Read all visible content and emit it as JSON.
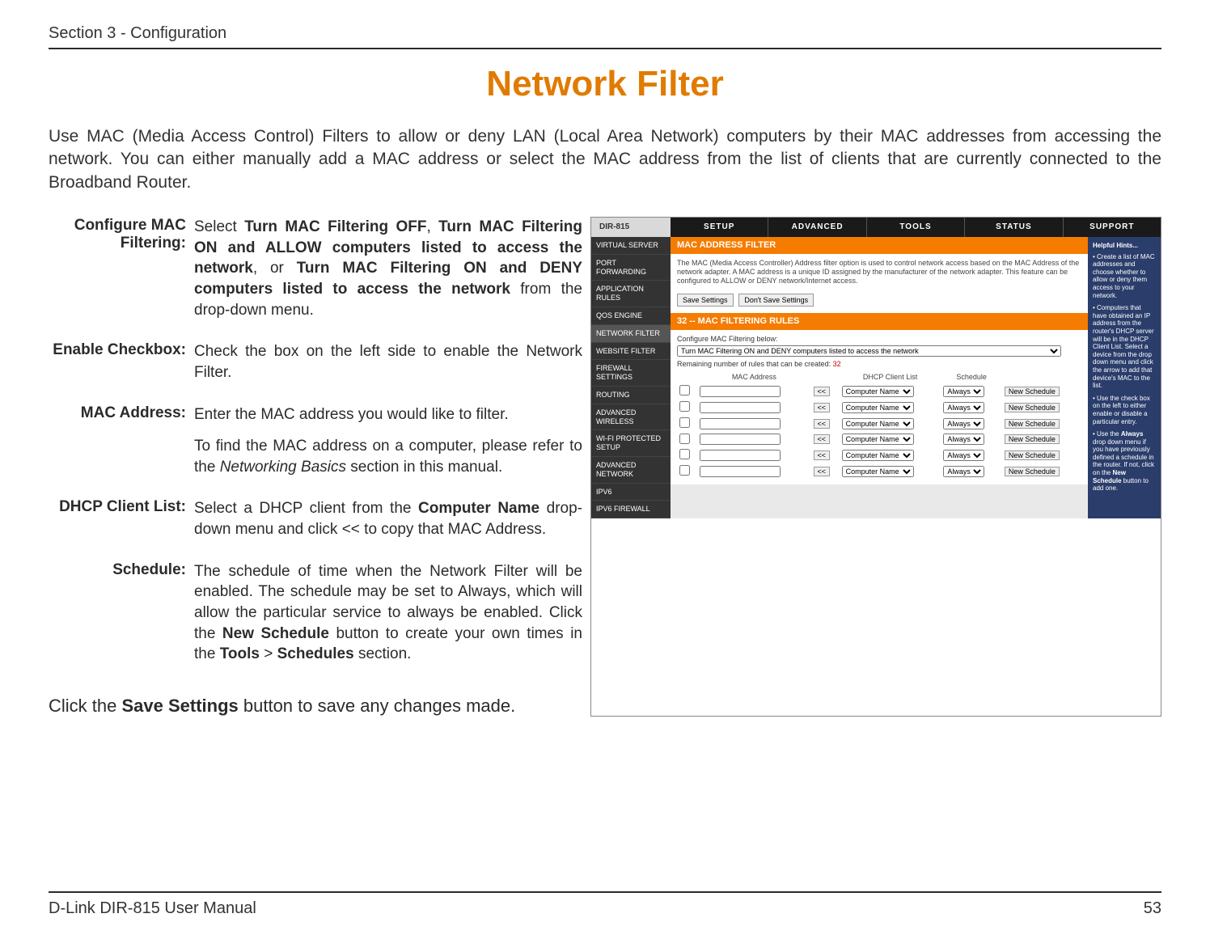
{
  "header": {
    "section": "Section 3 - Configuration"
  },
  "title": "Network Filter",
  "intro": "Use MAC (Media Access Control) Filters to allow or deny LAN (Local Area Network) computers by their MAC addresses from accessing the network. You can either manually add a MAC address or select the MAC address from the list of clients that are currently connected to the Broadband Router.",
  "definitions": {
    "configure": {
      "label": "Configure MAC Filtering:",
      "p1a": "Select ",
      "p1b": "Turn MAC Filtering OFF",
      "p1c": ", ",
      "p1d": "Turn MAC Filtering ON and ALLOW computers listed to access the network",
      "p1e": ", or ",
      "p1f": "Turn MAC Filtering ON and DENY computers listed to access the network",
      "p1g": " from the drop-down menu."
    },
    "enable": {
      "label": "Enable Checkbox:",
      "text": "Check the box on the left side to enable the Network Filter."
    },
    "mac": {
      "label": "MAC Address:",
      "p1": "Enter the MAC address you would like to filter.",
      "p2a": "To find the MAC address on a computer, please refer to the ",
      "p2b": "Networking Basics",
      "p2c": " section in this manual."
    },
    "dhcp": {
      "label": "DHCP Client List:",
      "p1a": "Select a DHCP client from the ",
      "p1b": "Computer Name",
      "p1c": " drop-down menu and click << to copy that MAC Address."
    },
    "schedule": {
      "label": "Schedule:",
      "p1a": "The schedule of time when the Network Filter will be enabled. The schedule may be set to Always, which will allow the particular service to always be enabled. Click the ",
      "p1b": "New Schedule",
      "p1c": " button to create your own times in the ",
      "p1d": "Tools",
      "p1e": " > ",
      "p1f": "Schedules",
      "p1g": " section."
    }
  },
  "save_line": {
    "a": "Click the ",
    "b": "Save Settings",
    "c": " button to save any changes made."
  },
  "footer": {
    "left": "D-Link DIR-815 User Manual",
    "right": "53"
  },
  "screenshot": {
    "device": "DIR-815",
    "tabs": [
      "SETUP",
      "ADVANCED",
      "TOOLS",
      "STATUS",
      "SUPPORT"
    ],
    "sidebar": [
      "VIRTUAL SERVER",
      "PORT FORWARDING",
      "APPLICATION RULES",
      "QOS ENGINE",
      "NETWORK FILTER",
      "WEBSITE FILTER",
      "FIREWALL SETTINGS",
      "ROUTING",
      "ADVANCED WIRELESS",
      "WI-FI PROTECTED SETUP",
      "ADVANCED NETWORK",
      "IPv6",
      "IPv6 FIREWALL"
    ],
    "active_sidebar_index": 4,
    "section_title": "MAC ADDRESS FILTER",
    "section_desc": "The MAC (Media Access Controller) Address filter option is used to control network access based on the MAC Address of the network adapter. A MAC address is a unique ID assigned by the manufacturer of the network adapter. This feature can be configured to ALLOW or DENY network/Internet access.",
    "btn_save": "Save Settings",
    "btn_dont": "Don't Save Settings",
    "rules_title": "32 -- MAC FILTERING RULES",
    "configure_label": "Configure MAC Filtering below:",
    "configure_value": "Turn MAC Filtering ON and DENY computers listed to access the network",
    "remaining_a": "Remaining number of rules that can be created: ",
    "remaining_b": "32",
    "cols": {
      "mac": "MAC Address",
      "dhcp": "DHCP Client List",
      "sched": "Schedule"
    },
    "row": {
      "copy": "<<",
      "computer": "Computer Name",
      "always": "Always",
      "newsched": "New Schedule"
    },
    "row_count": 6,
    "hints": {
      "title": "Helpful Hints...",
      "p1": "• Create a list of MAC addresses and choose whether to allow or deny them access to your network.",
      "p2": "• Computers that have obtained an IP address from the router's DHCP server will be in the DHCP Client List. Select a device from the drop down menu and click the arrow to add that device's MAC to the list.",
      "p3": "• Use the check box on the left to either enable or disable a particular entry.",
      "p4a": "• Use the ",
      "p4b": "Always",
      "p4c": " drop down menu if you have previously defined a schedule in the router. If not, click on the ",
      "p4d": "New Schedule",
      "p4e": " button to add one."
    }
  }
}
